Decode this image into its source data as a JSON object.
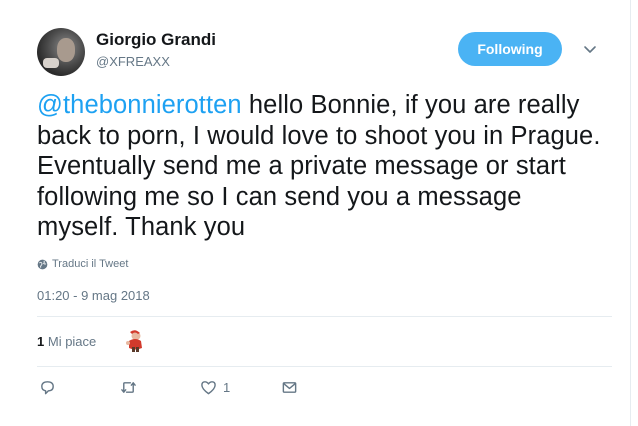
{
  "author": {
    "name": "Giorgio Grandi",
    "handle": "@XFREAXX"
  },
  "follow_button": {
    "label": "Following",
    "color": "#4ab3f4"
  },
  "tweet": {
    "mention": "@thebonnierotten",
    "body": " hello Bonnie, if you are really back to porn, I would love to shoot you in Prague. Eventually send me a private message or start following me so I can send you a message myself. Thank you"
  },
  "translate_label": "Traduci il Tweet",
  "timestamp": "01:20 - 9 mag 2018",
  "stats": {
    "likes_count": "1",
    "likes_label": "Mi piace"
  },
  "actions": {
    "reply_icon": "reply-icon",
    "retweet_icon": "retweet-icon",
    "like_icon": "heart-icon",
    "like_count": "1",
    "dm_icon": "envelope-icon"
  },
  "colors": {
    "link": "#1da1f2",
    "secondary_text": "#657786",
    "primary_text": "#14171a"
  }
}
